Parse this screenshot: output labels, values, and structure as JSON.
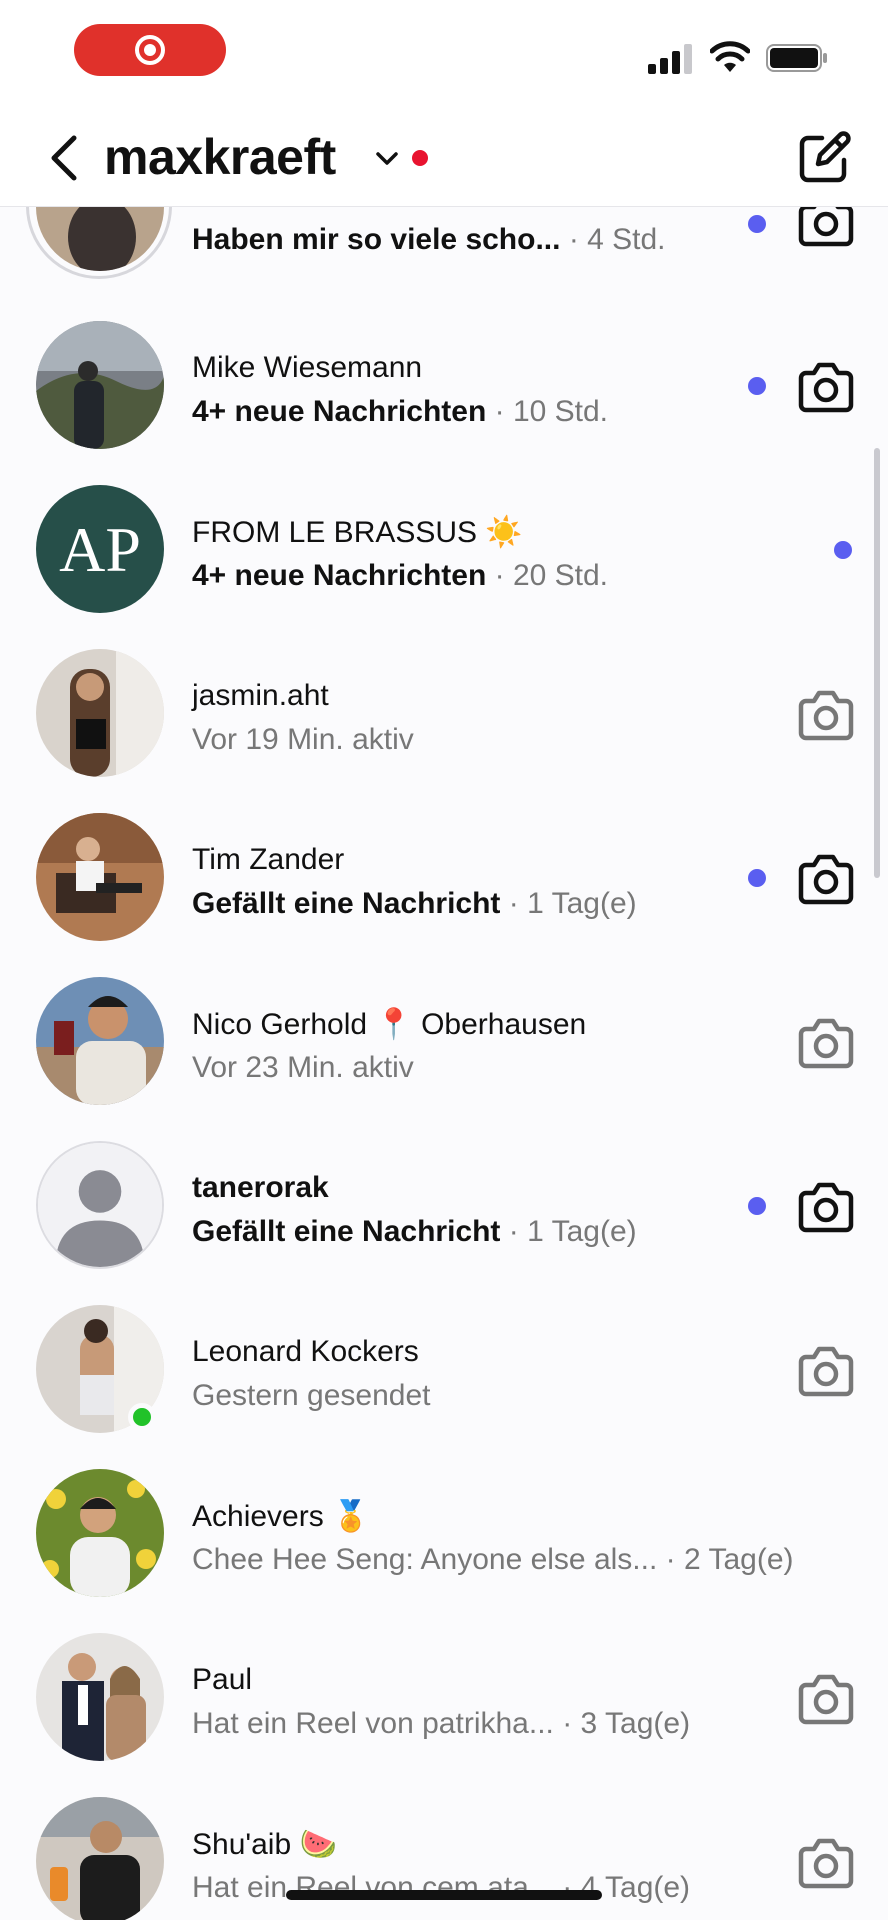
{
  "colors": {
    "accent_blue": "#5a5ef0",
    "recording_red": "#e0312b",
    "online_green": "#21c229",
    "unread_red": "#e8132f"
  },
  "header": {
    "username": "maxkraeft",
    "back_icon": "chevron-left-icon",
    "dropdown_icon": "chevron-down-icon",
    "compose_icon": "compose-icon"
  },
  "conversations": [
    {
      "name": "",
      "message": "Haben mir so viele scho...",
      "time": "· 4 Std.",
      "unread": true,
      "camera": true
    },
    {
      "name": "Mike Wiesemann",
      "message": "4+ neue Nachrichten",
      "time": "· 10 Std.",
      "unread": true,
      "camera": true
    },
    {
      "name": "FROM LE BRASSUS ☀️",
      "message": "4+ neue Nachrichten",
      "time": "· 20 Std.",
      "unread": true,
      "camera": false
    },
    {
      "name": "jasmin.aht",
      "message": "Vor 19 Min. aktiv",
      "time": "",
      "unread": false,
      "camera": true
    },
    {
      "name": "Tim Zander",
      "message": "Gefällt eine Nachricht",
      "time": "· 1 Tag(e)",
      "unread": true,
      "camera": true
    },
    {
      "name": "Nico Gerhold 📍 Oberhausen",
      "message": "Vor 23 Min. aktiv",
      "time": "",
      "unread": false,
      "camera": true
    },
    {
      "name": "tanerorak",
      "message": "Gefällt eine Nachricht",
      "time": "· 1 Tag(e)",
      "unread": true,
      "camera": true
    },
    {
      "name": "Leonard Kockers",
      "message": "Gestern gesendet",
      "time": "",
      "unread": false,
      "camera": true,
      "online": true
    },
    {
      "name": "Achievers 🏅",
      "message": "Chee Hee Seng: Anyone else als...",
      "time": "· 2 Tag(e)",
      "unread": false,
      "camera": false
    },
    {
      "name": "Paul",
      "message": "Hat ein Reel von patrikha...",
      "time": "· 3 Tag(e)",
      "unread": false,
      "camera": true
    },
    {
      "name": "Shu'aib 🍉",
      "message": "Hat ein Reel von cem.ata...",
      "time": "· 4 Tag(e)",
      "unread": false,
      "camera": true
    }
  ]
}
